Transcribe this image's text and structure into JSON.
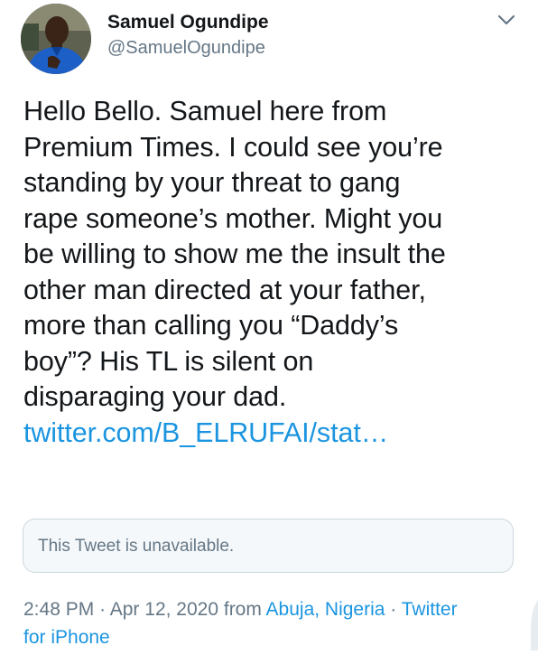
{
  "author": {
    "display_name": "Samuel Ogundipe",
    "handle": "@SamuelOgundipe",
    "avatar_icon": "profile-photo"
  },
  "menu": {
    "icon": "chevron-down-icon"
  },
  "tweet": {
    "lines": [
      "Hello Bello. Samuel here from",
      "Premium Times. I could see you’re",
      "standing by your threat to gang",
      "rape someone’s mother. Might you",
      "be willing to show me the insult the",
      "other man directed at your father,",
      "more than calling you “Daddy’s",
      "boy”? His TL is silent on",
      "disparaging your dad."
    ],
    "link": "twitter.com/B_ELRUFAI/stat…"
  },
  "quoted_tweet": {
    "message": "This Tweet is unavailable."
  },
  "meta": {
    "time": "2:48 PM",
    "separator": "·",
    "date": "Apr 12, 2020",
    "from_word": "from",
    "location": "Abuja, Nigeria",
    "source_line1": "Twitter",
    "source_line2": "for iPhone"
  },
  "colors": {
    "text": "#14171a",
    "secondary": "#657786",
    "link": "#1b95e0",
    "card_border": "#ccd6dd",
    "card_bg": "#f5f8fa"
  }
}
